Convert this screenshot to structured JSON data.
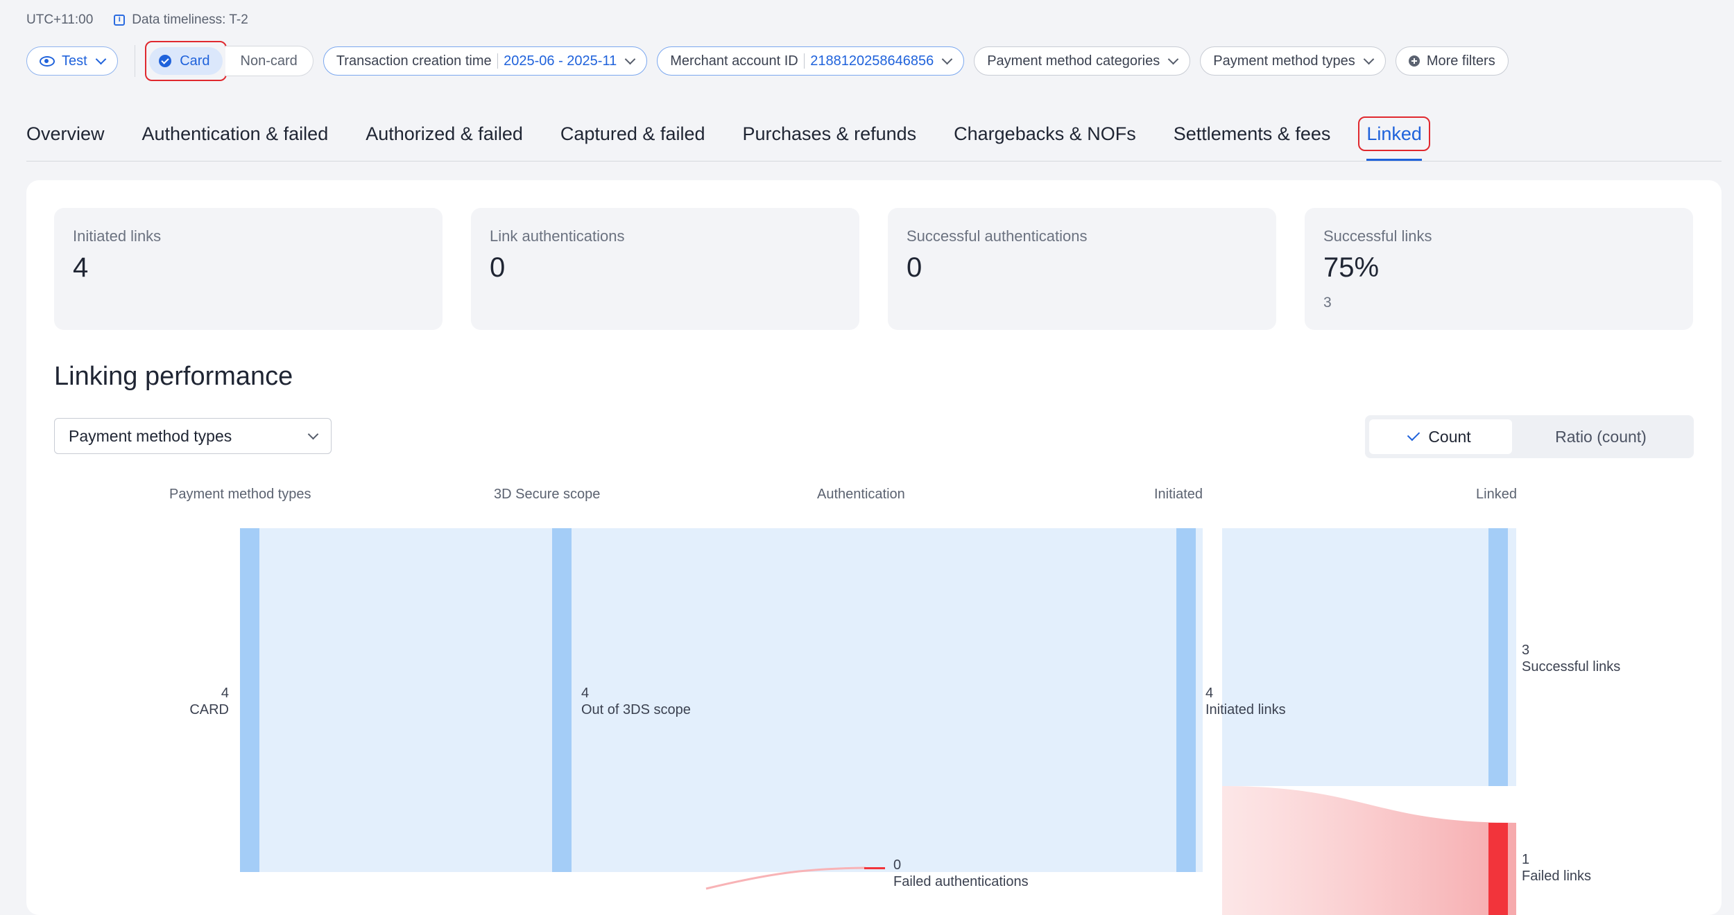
{
  "header": {
    "timezone": "UTC+11:00",
    "timeliness": "Data timeliness: T-2"
  },
  "filters": {
    "env": "Test",
    "card": "Card",
    "noncard": "Non-card",
    "time_label": "Transaction creation time",
    "time_value": "2025-06 - 2025-11",
    "merchant_label": "Merchant account ID",
    "merchant_value": "2188120258646856",
    "pm_categories": "Payment method categories",
    "pm_types": "Payment method types",
    "more": "More filters"
  },
  "tabs": [
    {
      "label": "Overview"
    },
    {
      "label": "Authentication & failed"
    },
    {
      "label": "Authorized & failed"
    },
    {
      "label": "Captured & failed"
    },
    {
      "label": "Purchases & refunds"
    },
    {
      "label": "Chargebacks & NOFs"
    },
    {
      "label": "Settlements & fees"
    },
    {
      "label": "Linked"
    }
  ],
  "kpis": [
    {
      "label": "Initiated links",
      "value": "4"
    },
    {
      "label": "Link authentications",
      "value": "0"
    },
    {
      "label": "Successful authentications",
      "value": "0"
    },
    {
      "label": "Successful links",
      "value": "75%",
      "sub": "3"
    }
  ],
  "section": {
    "title": "Linking performance",
    "dropdown": "Payment method types",
    "toggle_count": "Count",
    "toggle_ratio": "Ratio (count)"
  },
  "sankey": {
    "columns": [
      "Payment method types",
      "3D Secure scope",
      "Authentication",
      "Initiated",
      "Linked"
    ],
    "nodes": [
      {
        "value": "4",
        "label": "CARD"
      },
      {
        "value": "4",
        "label": "Out of 3DS scope"
      },
      {
        "value": "0",
        "label": "Failed authentications"
      },
      {
        "value": "4",
        "label": "Initiated links"
      },
      {
        "value": "3",
        "label": "Successful links"
      },
      {
        "value": "1",
        "label": "Failed links"
      }
    ],
    "colors": {
      "node": "#a4cdf7",
      "flow": "#e3effc",
      "fail_node": "#f2343b",
      "fail_flow": "#f8b3b6"
    }
  }
}
